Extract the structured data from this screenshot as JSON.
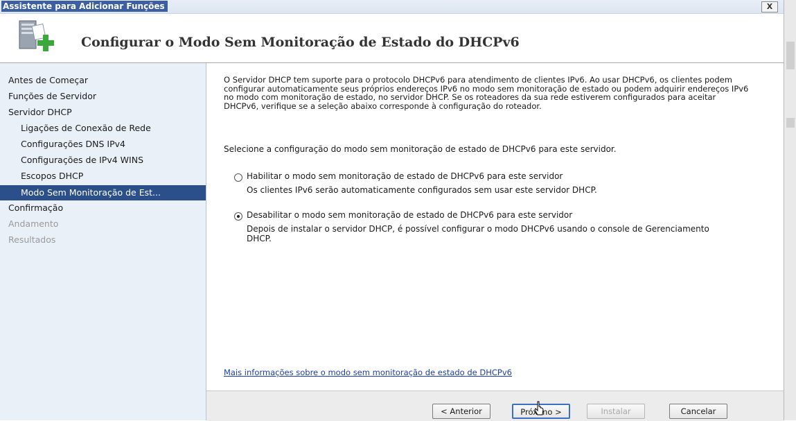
{
  "window": {
    "title": "Assistente para Adicionar Funções",
    "close_label": "X"
  },
  "header": {
    "title": "Configurar o Modo Sem Monitoração de Estado do DHCPv6",
    "icon": "server-add-icon"
  },
  "nav": {
    "items": [
      {
        "label": "Antes de Começar",
        "state": "normal"
      },
      {
        "label": "Funções de Servidor",
        "state": "normal"
      },
      {
        "label": "Servidor DHCP",
        "state": "normal"
      },
      {
        "label": "Ligações de Conexão de Rede",
        "state": "sub"
      },
      {
        "label": "Configurações DNS IPv4",
        "state": "sub"
      },
      {
        "label": "Configurações de IPv4 WINS",
        "state": "sub"
      },
      {
        "label": "Escopos DHCP",
        "state": "sub"
      },
      {
        "label": "Modo Sem Monitoração de Est...",
        "state": "selected"
      },
      {
        "label": "Confirmação",
        "state": "normal"
      },
      {
        "label": "Andamento",
        "state": "disabled"
      },
      {
        "label": "Resultados",
        "state": "disabled"
      }
    ]
  },
  "content": {
    "description": "O Servidor DHCP tem suporte para o protocolo DHCPv6 para atendimento de clientes IPv6. Ao usar DHCPv6, os clientes podem configurar automaticamente seus próprios endereços IPv6 no modo sem monitoração de estado ou podem adquirir endereços IPv6 no modo com monitoração de estado, no servidor DHCP. Se os roteadores da sua rede estiverem configurados para aceitar DHCPv6, verifique se a seleção abaixo corresponde à configuração do roteador.",
    "prompt": "Selecione a configuração do modo sem monitoração de estado de DHCPv6 para este servidor.",
    "options": [
      {
        "label": "Habilitar o modo sem monitoração de estado de DHCPv6 para este servidor",
        "description": "Os clientes IPv6 serão automaticamente configurados sem usar este servidor DHCP.",
        "checked": false
      },
      {
        "label": "Desabilitar o modo sem monitoração de estado de DHCPv6 para este servidor",
        "description": "Depois de instalar o servidor DHCP, é possível configurar o modo DHCPv6 usando o console de Gerenciamento DHCP.",
        "checked": true
      }
    ],
    "link": "Mais informações sobre o modo sem monitoração de estado de DHCPv6"
  },
  "footer": {
    "back_label": "< Anterior",
    "next_label": "Próximo >",
    "install_label": "Instalar",
    "cancel_label": "Cancelar"
  }
}
